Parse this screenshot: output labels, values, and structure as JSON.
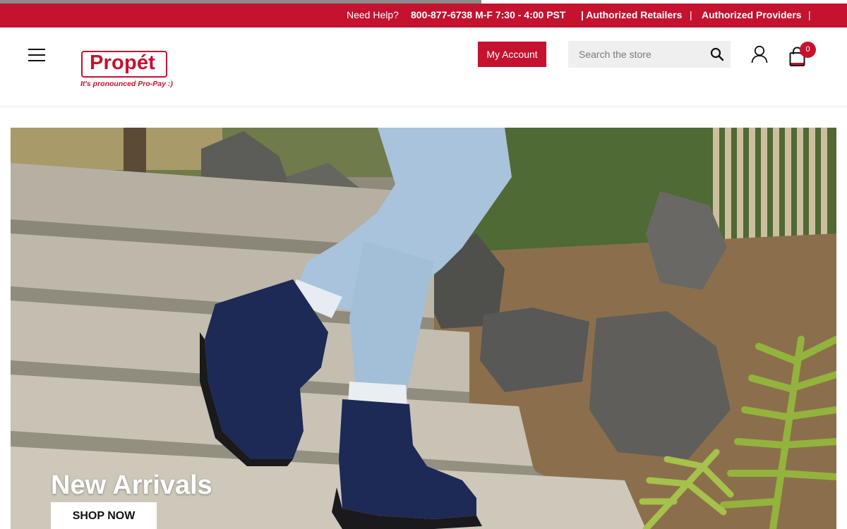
{
  "progress": {
    "fraction": 0.568
  },
  "topbar": {
    "help_label": "Need Help?",
    "phone_hours": "800-877-6738 M-F 7:30 - 4:00 PST",
    "retailers_link": "| Authorized Retailers",
    "sep1": "|",
    "providers_link": "Authorized Providers",
    "sep2": "|"
  },
  "header": {
    "menu_icon": "hamburger-icon",
    "logo_text": "Propét",
    "logo_tagline": "It's pronounced Pro-Pay :)",
    "account_label": "My Account",
    "search": {
      "placeholder": "Search the store",
      "value": "",
      "icon": "search-icon"
    },
    "user_icon": "user-icon",
    "cart": {
      "icon": "shopping-bag-icon",
      "count": "0"
    }
  },
  "hero": {
    "title": "New Arrivals",
    "button_label": "SHOP NOW"
  },
  "colors": {
    "brand_red": "#c4122f",
    "search_bg": "#efefef"
  }
}
